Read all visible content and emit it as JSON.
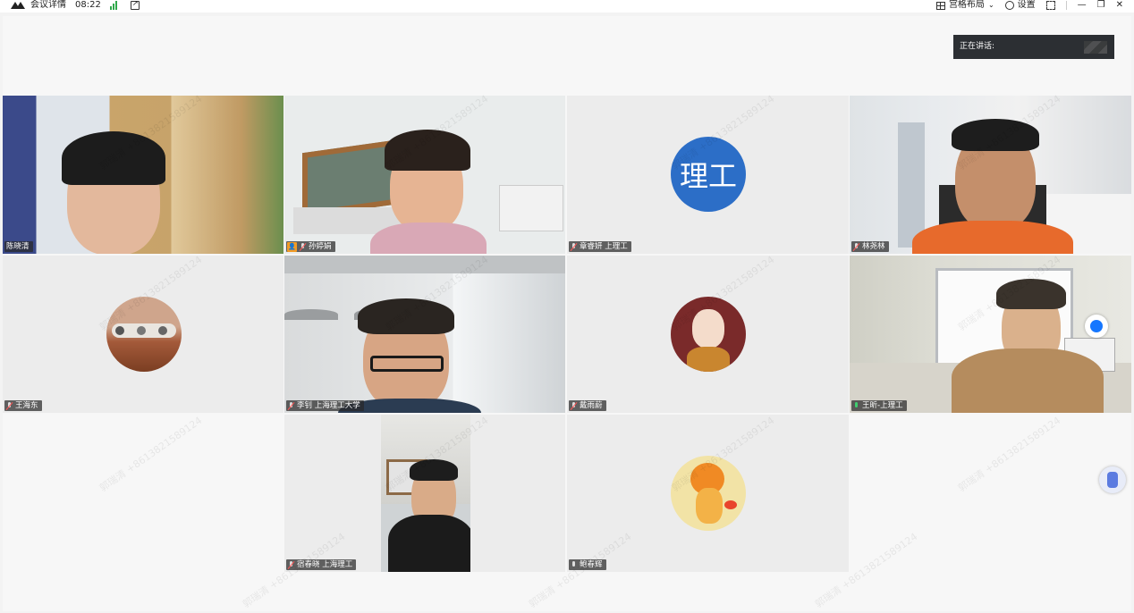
{
  "topbar": {
    "meeting_details": "会议详情",
    "time": "08:22",
    "layout_label": "宫格布局",
    "settings_label": "设置"
  },
  "speaking_label": "正在讲话:",
  "watermark": "郭瑞清 +8613821589124",
  "participants": [
    {
      "name": "陈晓清"
    },
    {
      "name": "孙婷娟"
    },
    {
      "name": "章睿妍 上理工",
      "avatar_text": "理工"
    },
    {
      "name": "林尧林"
    },
    {
      "name": "王海东"
    },
    {
      "name": "李钊 上海理工大学"
    },
    {
      "name": "戴雨蔚"
    },
    {
      "name": "王昕-上理工"
    },
    {
      "name": "宿春晓 上海理工"
    },
    {
      "name": "鲍春辉"
    }
  ],
  "colors": {
    "brand_blue": "#2c6ec7",
    "host_orange": "#f29b26",
    "signal_green": "#2ea84a"
  }
}
